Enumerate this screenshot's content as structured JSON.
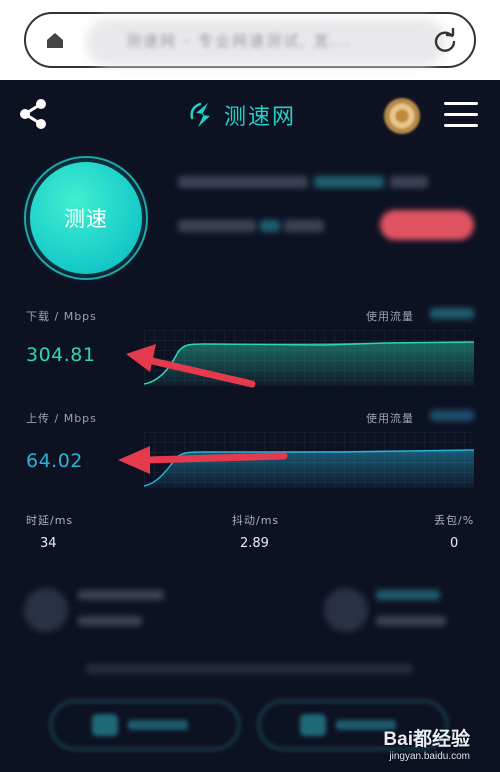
{
  "browser": {
    "url": "测速网 - 专业网速测试, 宽..."
  },
  "header": {
    "brand_name": "测速网"
  },
  "speed_test": {
    "button_label": "测速"
  },
  "download": {
    "label": "下载 / Mbps",
    "value": "304.81",
    "usage_label": "使用流量",
    "color": "#2fd6b4"
  },
  "upload": {
    "label": "上传 / Mbps",
    "value": "64.02",
    "usage_label": "使用流量",
    "color": "#2ab3d6"
  },
  "metrics": {
    "latency_label": "时延/ms",
    "latency_value": "34",
    "jitter_label": "抖动/ms",
    "jitter_value": "2.89",
    "loss_label": "丢包/%",
    "loss_value": "0"
  },
  "watermark": {
    "brand": "Bai都经验",
    "domain": "jingyan.baidu.com"
  },
  "colors": {
    "accent": "#23d1c7",
    "background": "#0d1223",
    "arrow": "#e53a4e"
  }
}
